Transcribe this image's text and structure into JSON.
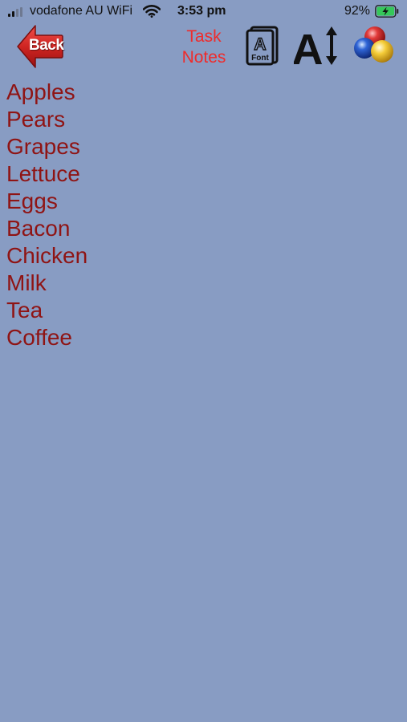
{
  "status_bar": {
    "carrier": "vodafone AU WiFi",
    "time": "3:53 pm",
    "battery": "92%"
  },
  "toolbar": {
    "back_label": "Back",
    "title_line1": "Task",
    "title_line2": "Notes",
    "font_icon_label": "Font",
    "font_icon_letter": "A",
    "font_size_letter": "A"
  },
  "notes": [
    "Apples",
    "Pears",
    "Grapes",
    "Lettuce",
    "Eggs",
    "Bacon",
    "Chicken",
    "Milk",
    "Tea",
    "Coffee"
  ],
  "colors": {
    "background": "#889cc3",
    "note_text": "#8f1414",
    "title_text": "#ef2b2b",
    "back_arrow": "#c7201f",
    "battery_fill": "#35c759"
  },
  "icons": {
    "signal": "cellular-signal-icon",
    "wifi": "wifi-icon",
    "battery": "battery-charging-icon",
    "back": "back-arrow-icon",
    "font": "font-icon",
    "font_size": "font-size-icon",
    "color": "color-balls-icon"
  }
}
